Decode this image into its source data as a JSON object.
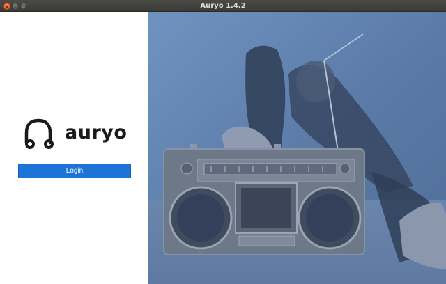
{
  "window": {
    "title": "Auryo 1.4.2"
  },
  "window_controls": {
    "close_glyph": "×",
    "minimize_glyph": "–",
    "maximize_glyph": "□"
  },
  "brand": {
    "name": "auryo",
    "logo_icon": "headphones-icon"
  },
  "login": {
    "label": "Login"
  },
  "hero_image": {
    "description_icon": "boombox-photo",
    "tint": "#5d82ad"
  }
}
